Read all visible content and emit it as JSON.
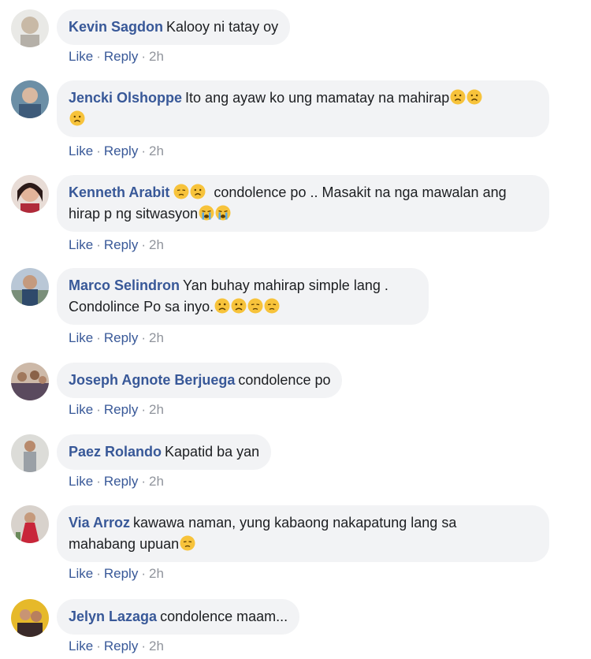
{
  "actions": {
    "like": "Like",
    "reply": "Reply",
    "separator": "·"
  },
  "comments": [
    {
      "author": "Kevin Sagdon",
      "text": "Kalooy ni tatay oy",
      "time": "2h"
    },
    {
      "author": "Jencki Olshoppe",
      "text": "Ito ang ayaw ko ung mamatay na mahirap",
      "time": "2h",
      "emojis": [
        "sad-face-emoji",
        "sad-face-emoji",
        "sad-face-emoji"
      ]
    },
    {
      "author": "Kenneth Arabit",
      "text": "condolence po .. Masakit na nga mawalan ang hirap p ng sitwasyon",
      "time": "2h",
      "emojis_lead": [
        "pensive-face-emoji",
        "sad-face-emoji"
      ],
      "emojis": [
        "crying-face-emoji",
        "crying-face-emoji"
      ]
    },
    {
      "author": "Marco Selindron",
      "text_line1": "Yan buhay mahirap simple lang .",
      "text_line2": "Condolince Po sa inyo.",
      "time": "2h",
      "emojis": [
        "frowning-face-emoji",
        "frowning-face-emoji",
        "pensive-face-emoji",
        "pensive-face-emoji"
      ]
    },
    {
      "author": "Joseph Agnote Berjuega",
      "text": "condolence po",
      "time": "2h"
    },
    {
      "author": "Paez Rolando",
      "text": "Kapatid ba yan",
      "time": "2h"
    },
    {
      "author": "Via Arroz",
      "text_line1": "kawawa naman, yung kabaong nakapatung lang sa",
      "text_line2": "mahabang upuan",
      "time": "2h",
      "emojis": [
        "pensive-face-emoji"
      ]
    },
    {
      "author": "Jelyn Lazaga",
      "text": "condolence maam...",
      "time": "2h"
    }
  ],
  "colors": {
    "author": "#385898",
    "bubble": "#f2f3f5",
    "meta": "#90949c",
    "emoji": "#f7c33b"
  }
}
